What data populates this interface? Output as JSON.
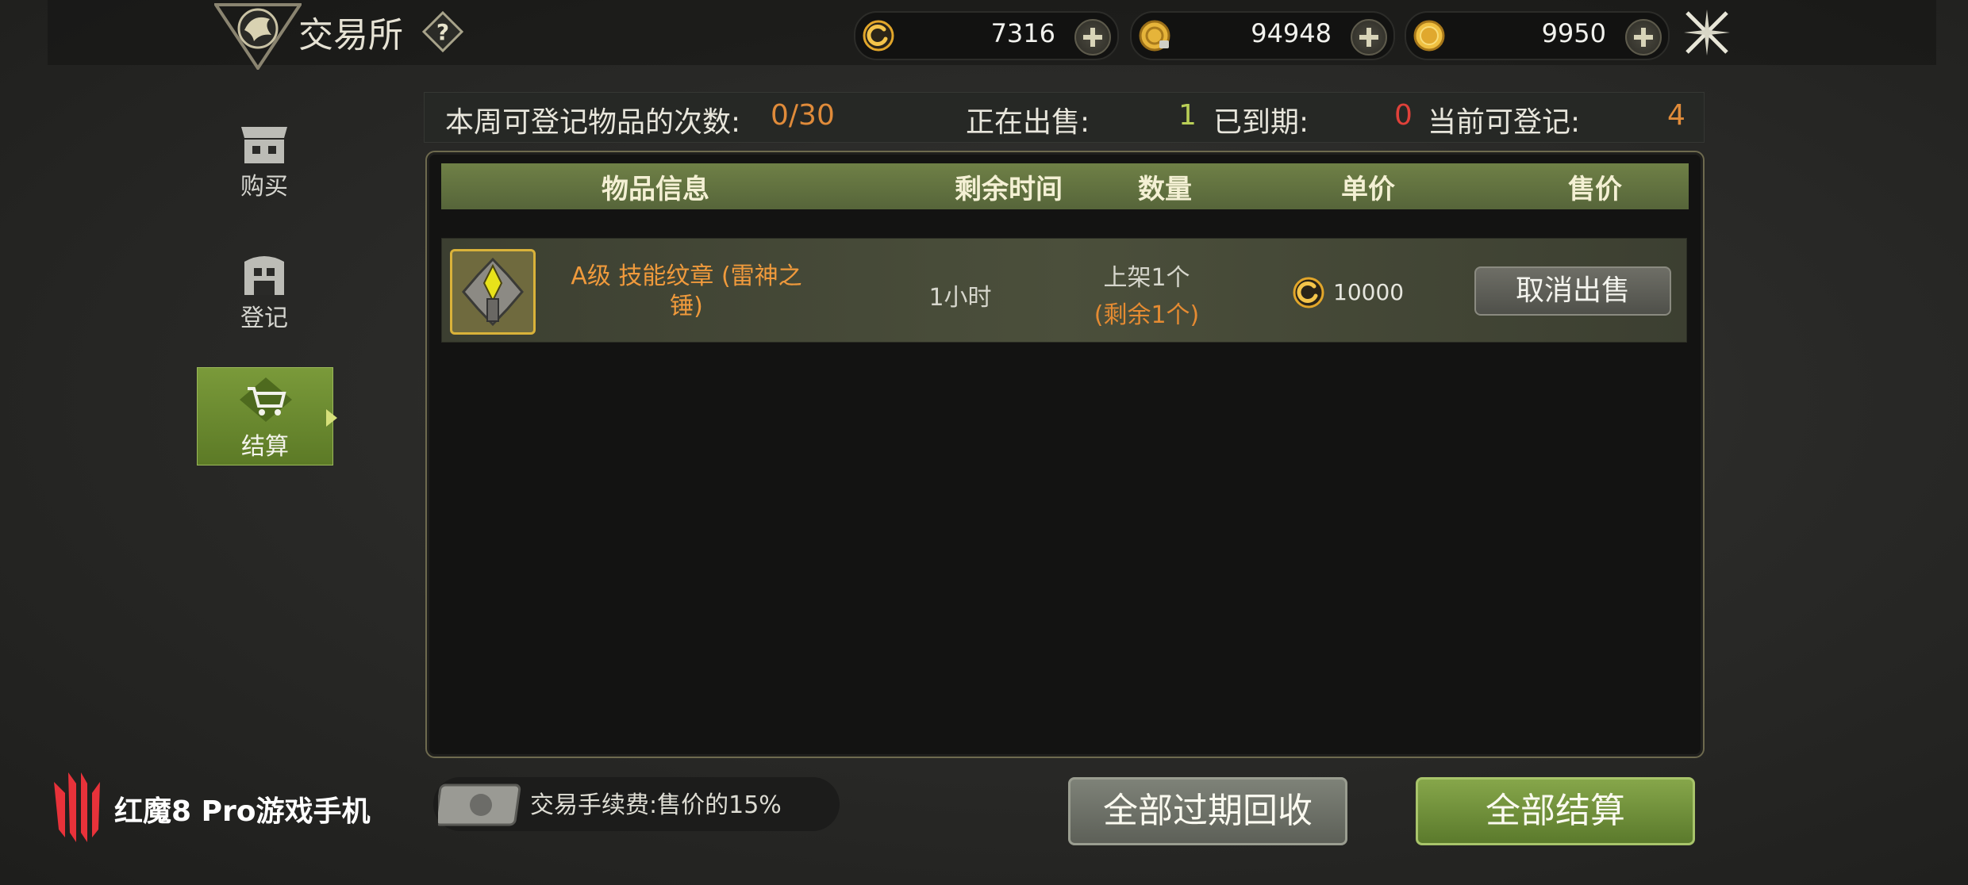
{
  "header": {
    "title": "交易所",
    "help_icon": "question-diamond-icon",
    "currencies": [
      {
        "name": "swirl-coin-icon",
        "value": "7316"
      },
      {
        "name": "lock-gold-coin-icon",
        "value": "94948"
      },
      {
        "name": "gold-coin-icon",
        "value": "9950"
      }
    ],
    "close_icon": "crossed-swords-close-icon"
  },
  "sidebar": {
    "items": [
      {
        "label": "购买",
        "icon": "shop-icon",
        "active": false
      },
      {
        "label": "登记",
        "icon": "register-building-icon",
        "active": false
      },
      {
        "label": "结算",
        "icon": "cart-icon",
        "active": true
      }
    ]
  },
  "stats": {
    "weekly_label": "本周可登记物品的次数:",
    "weekly_value": "0/30",
    "on_sale_label": "正在出售:",
    "on_sale_value": "1",
    "expired_label": "已到期:",
    "expired_value": "0",
    "available_label": "当前可登记:",
    "available_value": "4"
  },
  "table": {
    "columns": [
      "物品信息",
      "剩余时间",
      "数量",
      "单价",
      "售价"
    ],
    "rows": [
      {
        "item_name": "A级 技能纹章 (雷神之锤)",
        "item_name_line1": "A级 技能纹章 (雷神之",
        "item_name_line2": "锤)",
        "remaining_time": "1小时",
        "quantity_listed": "上架1个",
        "quantity_left": "(剩余1个)",
        "unit_price": "10000",
        "action_label": "取消出售"
      }
    ]
  },
  "footer": {
    "fee_text": "交易手续费:售价的15%",
    "reclaim_all_label": "全部过期回收",
    "settle_all_label": "全部结算"
  },
  "brand": {
    "text": "红魔8 Pro游戏手机"
  },
  "colors": {
    "accent_green": "#6f8046",
    "orange": "#e58b32",
    "red": "#e0413a",
    "lime": "#b9cf56"
  }
}
